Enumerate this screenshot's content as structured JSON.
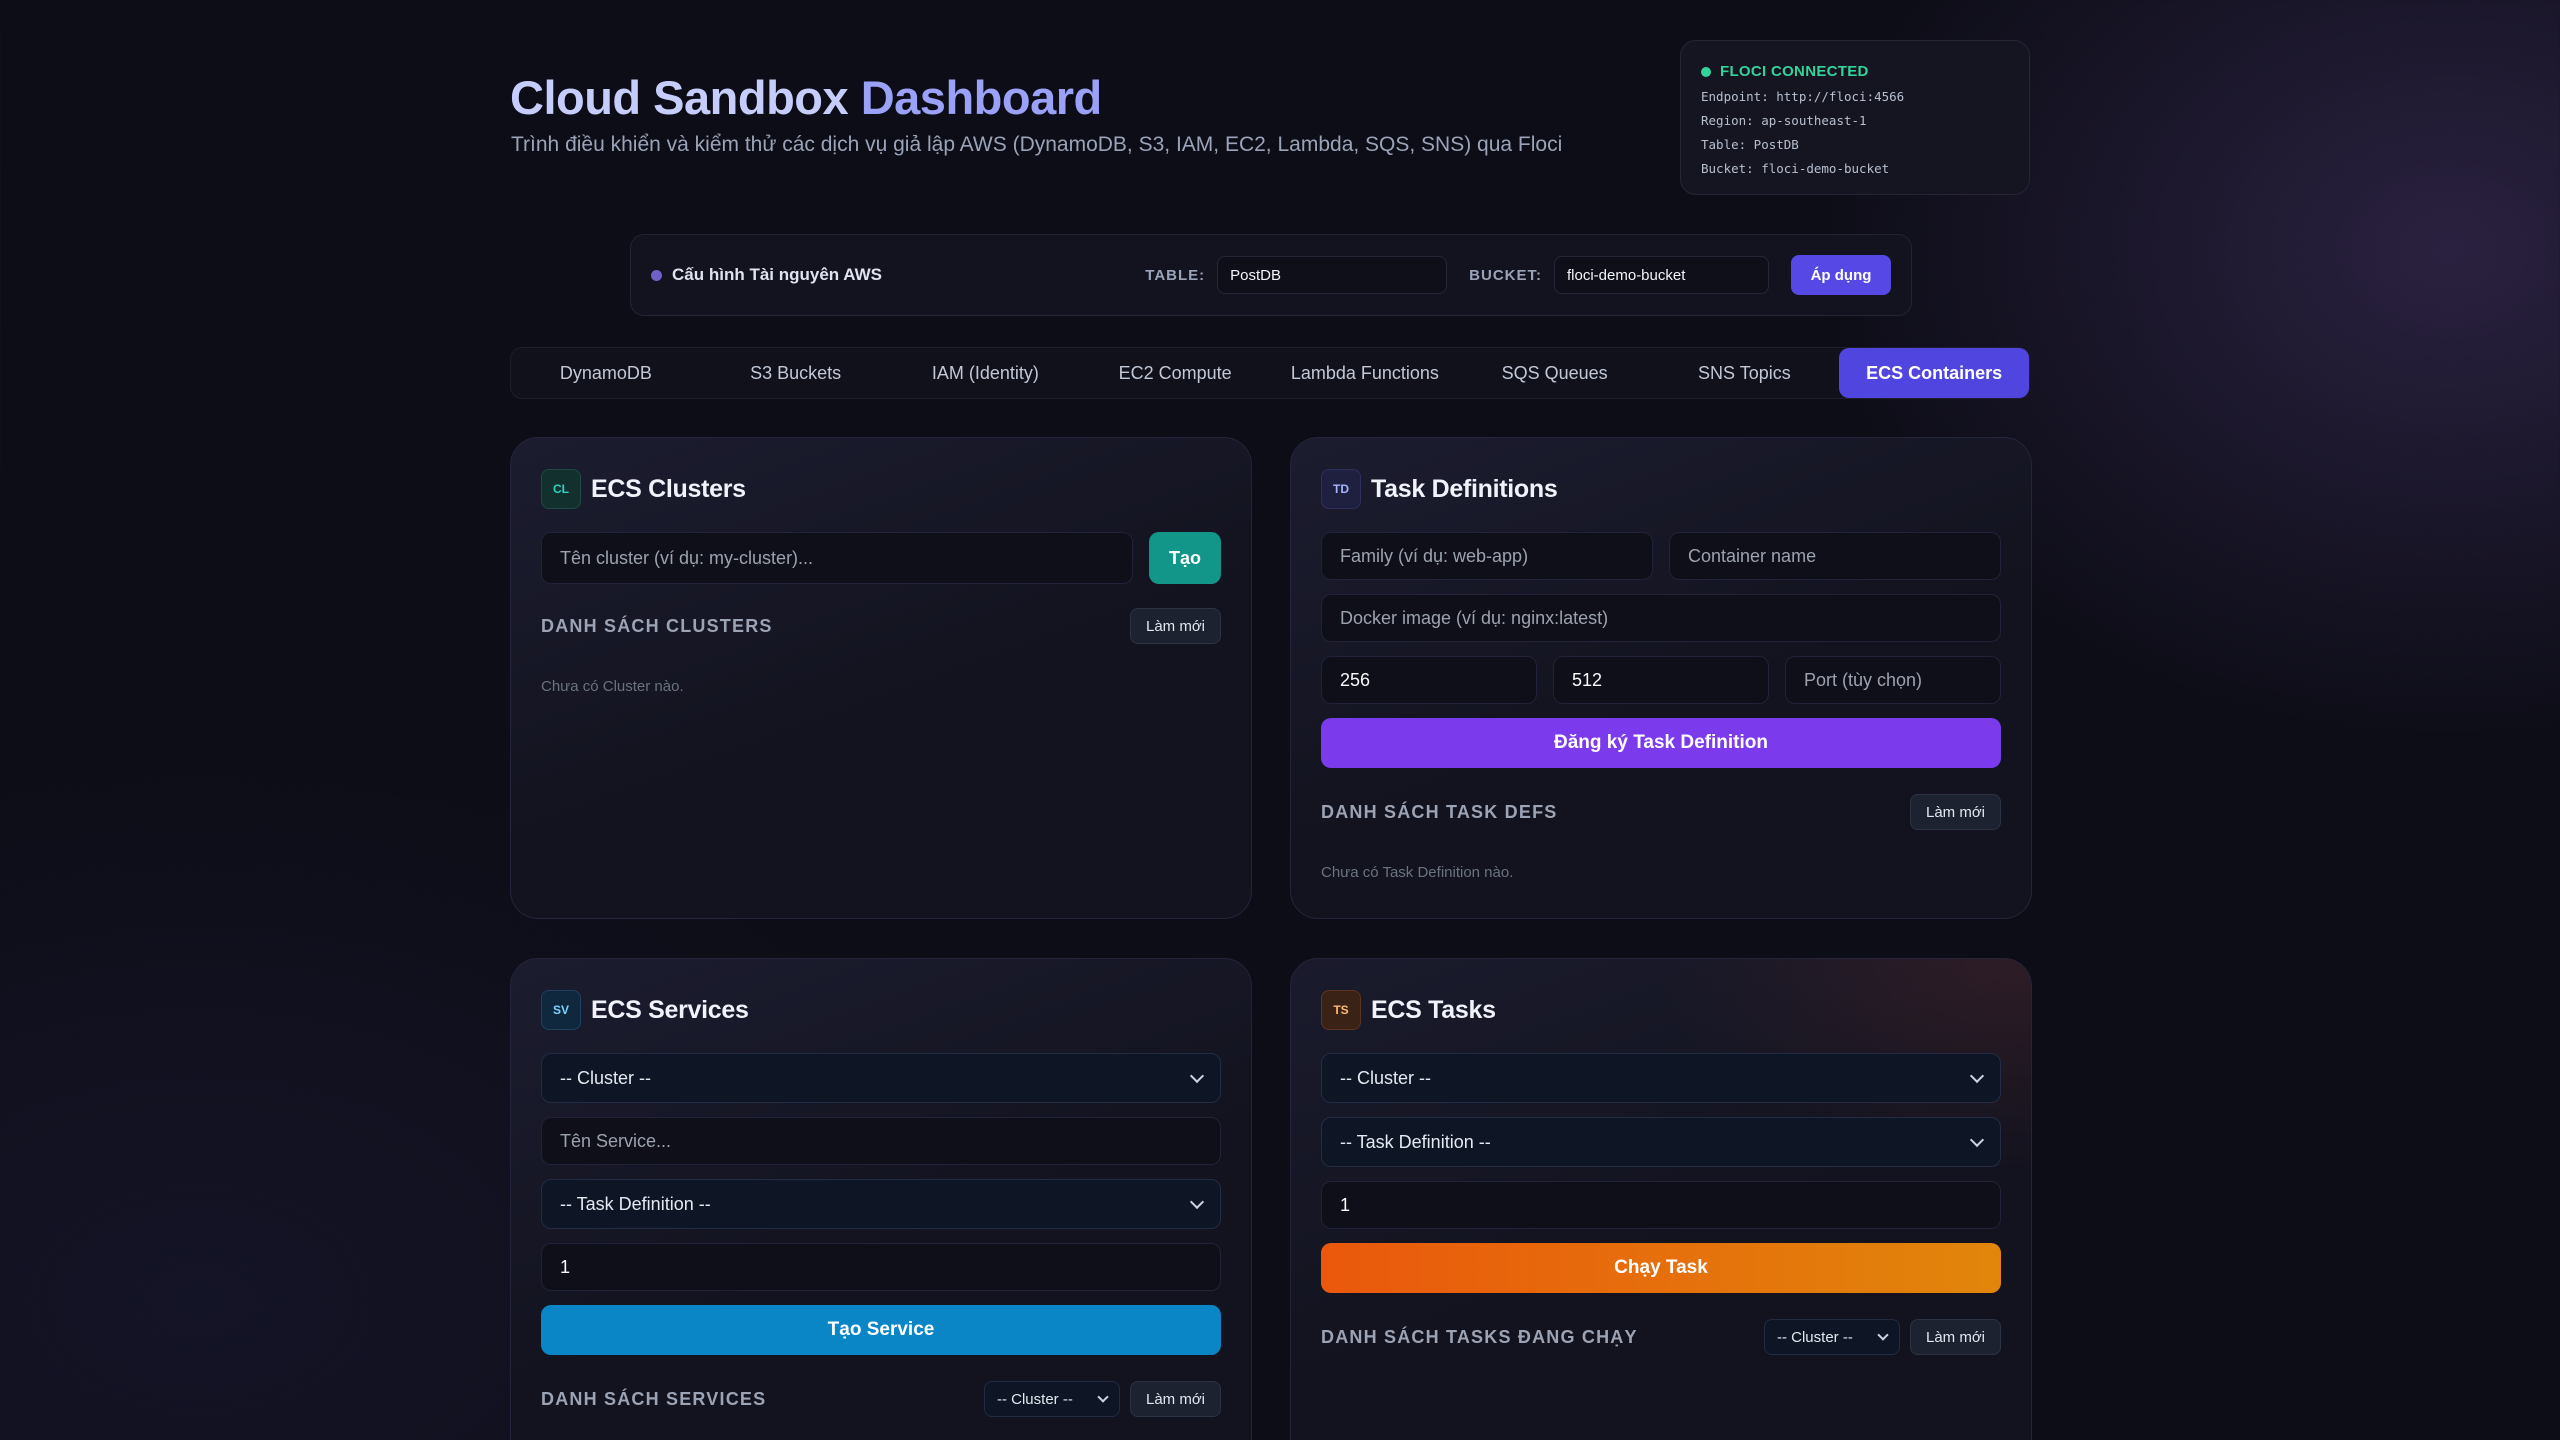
{
  "header": {
    "title_main": "Cloud Sandbox",
    "title_accent": "Dashboard",
    "subtitle": "Trình điều khiển và kiểm thử các dịch vụ giả lập AWS (DynamoDB, S3, IAM, EC2, Lambda, SQS, SNS) qua Floci"
  },
  "floci": {
    "status": "FLOCI CONNECTED",
    "endpoint": "Endpoint: http://floci:4566",
    "region": "Region: ap-southeast-1",
    "table": "Table: PostDB",
    "bucket": "Bucket: floci-demo-bucket"
  },
  "config": {
    "title": "Cấu hình Tài nguyên AWS",
    "table_label": "TABLE:",
    "table_value": "PostDB",
    "bucket_label": "BUCKET:",
    "bucket_value": "floci-demo-bucket",
    "apply_label": "Áp dụng"
  },
  "tabs": [
    {
      "label": "DynamoDB"
    },
    {
      "label": "S3 Buckets"
    },
    {
      "label": "IAM (Identity)"
    },
    {
      "label": "EC2 Compute"
    },
    {
      "label": "Lambda Functions"
    },
    {
      "label": "SQS Queues"
    },
    {
      "label": "SNS Topics"
    },
    {
      "label": "ECS Containers",
      "active": true
    }
  ],
  "clusters": {
    "badge": "CL",
    "title": "ECS Clusters",
    "name_placeholder": "Tên cluster (ví dụ: my-cluster)...",
    "create_label": "Tạo",
    "list_label": "DANH SÁCH CLUSTERS",
    "refresh_label": "Làm mới",
    "empty_text": "Chưa có Cluster nào."
  },
  "taskdefs": {
    "badge": "TD",
    "title": "Task Definitions",
    "family_placeholder": "Family (ví dụ: web-app)",
    "container_placeholder": "Container name",
    "image_placeholder": "Docker image (ví dụ: nginx:latest)",
    "cpu_value": "256",
    "memory_value": "512",
    "port_placeholder": "Port (tùy chọn)",
    "register_label": "Đăng ký Task Definition",
    "list_label": "DANH SÁCH TASK DEFS",
    "refresh_label": "Làm mới",
    "empty_text": "Chưa có Task Definition nào."
  },
  "services": {
    "badge": "SV",
    "title": "ECS Services",
    "cluster_select": "-- Cluster --",
    "name_placeholder": "Tên Service...",
    "taskdef_select": "-- Task Definition --",
    "count_value": "1",
    "create_label": "Tạo Service",
    "list_label": "DANH SÁCH SERVICES",
    "filter_select": "-- Cluster --",
    "refresh_label": "Làm mới"
  },
  "tasks": {
    "badge": "TS",
    "title": "ECS Tasks",
    "cluster_select": "-- Cluster --",
    "taskdef_select": "-- Task Definition --",
    "count_value": "1",
    "run_label": "Chạy Task",
    "list_label": "DANH SÁCH TASKS ĐANG CHẠY",
    "filter_select": "-- Cluster --",
    "refresh_label": "Làm mới"
  }
}
